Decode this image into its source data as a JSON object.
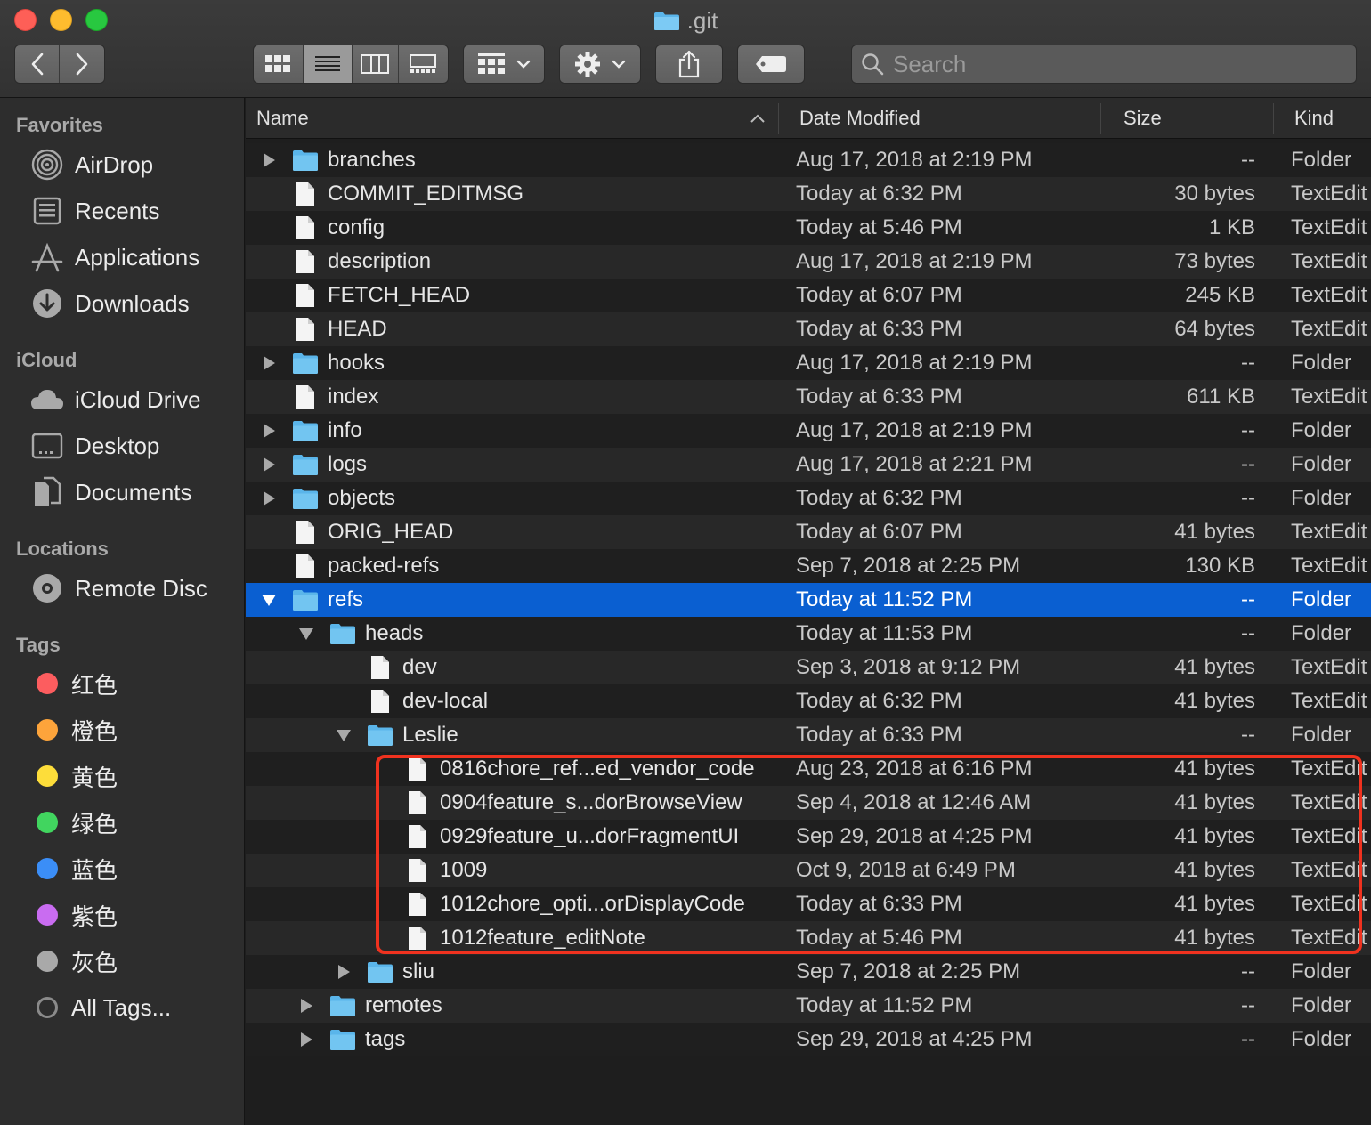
{
  "window": {
    "title": ".git"
  },
  "search": {
    "placeholder": "Search"
  },
  "sidebar": {
    "sections": [
      {
        "heading": "Favorites",
        "items": [
          {
            "label": "AirDrop",
            "icon": "airdrop-icon"
          },
          {
            "label": "Recents",
            "icon": "recents-icon"
          },
          {
            "label": "Applications",
            "icon": "applications-icon"
          },
          {
            "label": "Downloads",
            "icon": "downloads-icon"
          }
        ]
      },
      {
        "heading": "iCloud",
        "items": [
          {
            "label": "iCloud Drive",
            "icon": "cloud-icon"
          },
          {
            "label": "Desktop",
            "icon": "desktop-icon"
          },
          {
            "label": "Documents",
            "icon": "documents-icon"
          }
        ]
      },
      {
        "heading": "Locations",
        "items": [
          {
            "label": "Remote Disc",
            "icon": "disc-icon"
          }
        ]
      },
      {
        "heading": "Tags",
        "items": [
          {
            "label": "红色",
            "color": "#fc5d5f"
          },
          {
            "label": "橙色",
            "color": "#fda43b"
          },
          {
            "label": "黄色",
            "color": "#fddd3a"
          },
          {
            "label": "绿色",
            "color": "#41d55f"
          },
          {
            "label": "蓝色",
            "color": "#3b8ef7"
          },
          {
            "label": "紫色",
            "color": "#c96cf1"
          },
          {
            "label": "灰色",
            "color": "#a9a9a9"
          },
          {
            "label": "All Tags...",
            "color": "all"
          }
        ]
      }
    ]
  },
  "columns": {
    "name": "Name",
    "date": "Date Modified",
    "size": "Size",
    "kind": "Kind"
  },
  "files": [
    {
      "name": "branches",
      "date": "Aug 17, 2018 at 2:19 PM",
      "size": "--",
      "kind": "Folder",
      "type": "folder",
      "level": 0,
      "expanded": false
    },
    {
      "name": "COMMIT_EDITMSG",
      "date": "Today at 6:32 PM",
      "size": "30 bytes",
      "kind": "TextEdit",
      "type": "file",
      "level": 0
    },
    {
      "name": "config",
      "date": "Today at 5:46 PM",
      "size": "1 KB",
      "kind": "TextEdit",
      "type": "file",
      "level": 0
    },
    {
      "name": "description",
      "date": "Aug 17, 2018 at 2:19 PM",
      "size": "73 bytes",
      "kind": "TextEdit",
      "type": "file",
      "level": 0
    },
    {
      "name": "FETCH_HEAD",
      "date": "Today at 6:07 PM",
      "size": "245 KB",
      "kind": "TextEdit",
      "type": "file",
      "level": 0
    },
    {
      "name": "HEAD",
      "date": "Today at 6:33 PM",
      "size": "64 bytes",
      "kind": "TextEdit",
      "type": "file",
      "level": 0
    },
    {
      "name": "hooks",
      "date": "Aug 17, 2018 at 2:19 PM",
      "size": "--",
      "kind": "Folder",
      "type": "folder",
      "level": 0,
      "expanded": false
    },
    {
      "name": "index",
      "date": "Today at 6:33 PM",
      "size": "611 KB",
      "kind": "TextEdit",
      "type": "file",
      "level": 0
    },
    {
      "name": "info",
      "date": "Aug 17, 2018 at 2:19 PM",
      "size": "--",
      "kind": "Folder",
      "type": "folder",
      "level": 0,
      "expanded": false
    },
    {
      "name": "logs",
      "date": "Aug 17, 2018 at 2:21 PM",
      "size": "--",
      "kind": "Folder",
      "type": "folder",
      "level": 0,
      "expanded": false
    },
    {
      "name": "objects",
      "date": "Today at 6:32 PM",
      "size": "--",
      "kind": "Folder",
      "type": "folder",
      "level": 0,
      "expanded": false
    },
    {
      "name": "ORIG_HEAD",
      "date": "Today at 6:07 PM",
      "size": "41 bytes",
      "kind": "TextEdit",
      "type": "file",
      "level": 0
    },
    {
      "name": "packed-refs",
      "date": "Sep 7, 2018 at 2:25 PM",
      "size": "130 KB",
      "kind": "TextEdit",
      "type": "file",
      "level": 0
    },
    {
      "name": "refs",
      "date": "Today at 11:52 PM",
      "size": "--",
      "kind": "Folder",
      "type": "folder",
      "level": 0,
      "expanded": true,
      "selected": true
    },
    {
      "name": "heads",
      "date": "Today at 11:53 PM",
      "size": "--",
      "kind": "Folder",
      "type": "folder",
      "level": 1,
      "expanded": true
    },
    {
      "name": "dev",
      "date": "Sep 3, 2018 at 9:12 PM",
      "size": "41 bytes",
      "kind": "TextEdit",
      "type": "file",
      "level": 2
    },
    {
      "name": "dev-local",
      "date": "Today at 6:32 PM",
      "size": "41 bytes",
      "kind": "TextEdit",
      "type": "file",
      "level": 2
    },
    {
      "name": "Leslie",
      "date": "Today at 6:33 PM",
      "size": "--",
      "kind": "Folder",
      "type": "folder",
      "level": 2,
      "expanded": true
    },
    {
      "name": "0816chore_ref...ed_vendor_code",
      "date": "Aug 23, 2018 at 6:16 PM",
      "size": "41 bytes",
      "kind": "TextEdit",
      "type": "file",
      "level": 3
    },
    {
      "name": "0904feature_s...dorBrowseView",
      "date": "Sep 4, 2018 at 12:46 AM",
      "size": "41 bytes",
      "kind": "TextEdit",
      "type": "file",
      "level": 3
    },
    {
      "name": "0929feature_u...dorFragmentUI",
      "date": "Sep 29, 2018 at 4:25 PM",
      "size": "41 bytes",
      "kind": "TextEdit",
      "type": "file",
      "level": 3
    },
    {
      "name": "1009",
      "date": "Oct 9, 2018 at 6:49 PM",
      "size": "41 bytes",
      "kind": "TextEdit",
      "type": "file",
      "level": 3
    },
    {
      "name": "1012chore_opti...orDisplayCode",
      "date": "Today at 6:33 PM",
      "size": "41 bytes",
      "kind": "TextEdit",
      "type": "file",
      "level": 3
    },
    {
      "name": "1012feature_editNote",
      "date": "Today at 5:46 PM",
      "size": "41 bytes",
      "kind": "TextEdit",
      "type": "file",
      "level": 3
    },
    {
      "name": "sliu",
      "date": "Sep 7, 2018 at 2:25 PM",
      "size": "--",
      "kind": "Folder",
      "type": "folder",
      "level": 2,
      "expanded": false
    },
    {
      "name": "remotes",
      "date": "Today at 11:52 PM",
      "size": "--",
      "kind": "Folder",
      "type": "folder",
      "level": 1,
      "expanded": false
    },
    {
      "name": "tags",
      "date": "Sep 29, 2018 at 4:25 PM",
      "size": "--",
      "kind": "Folder",
      "type": "folder",
      "level": 1,
      "expanded": false
    }
  ],
  "colors": {
    "selection": "#0a5fd1",
    "highlight_box": "#f0321f",
    "folder": "#5ab5ea"
  }
}
